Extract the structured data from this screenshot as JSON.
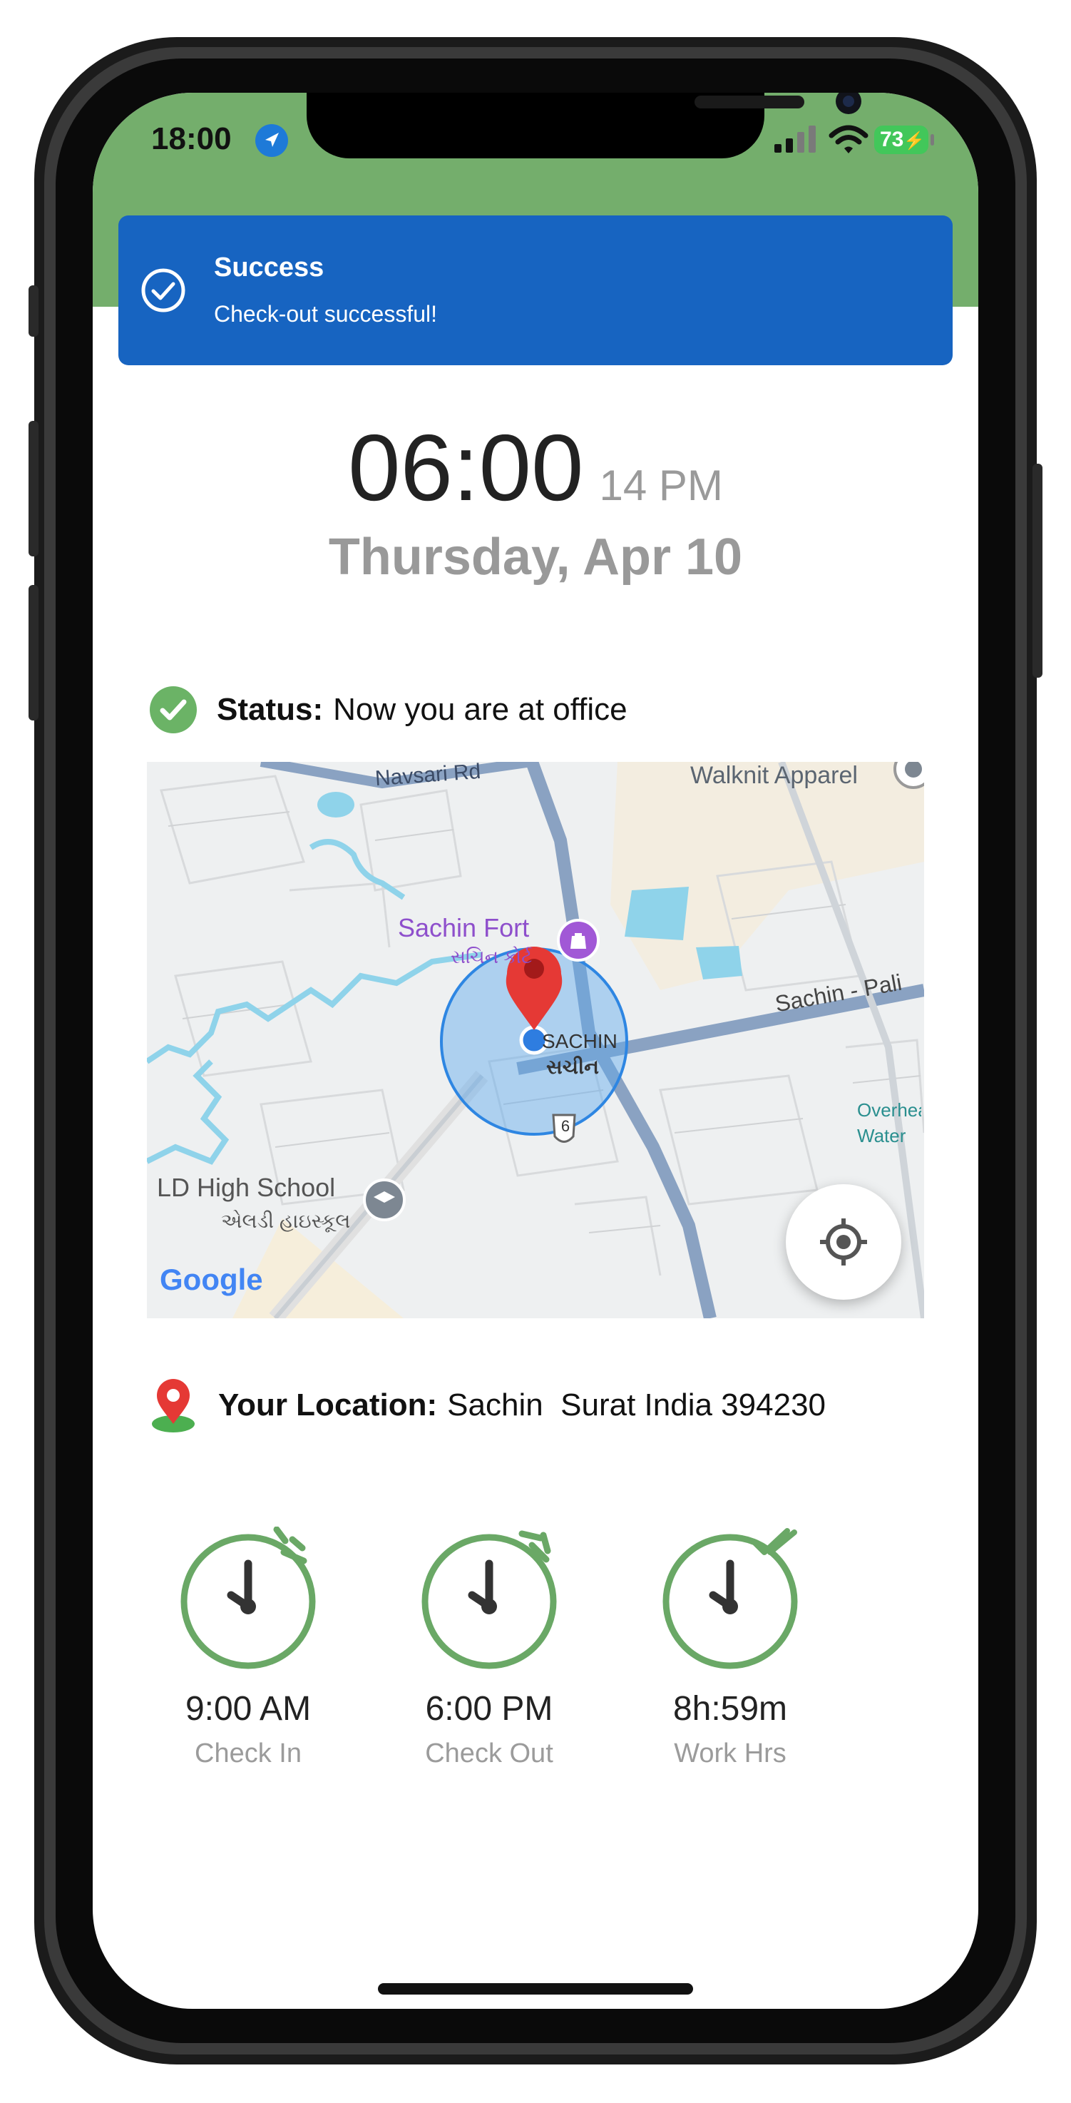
{
  "status_bar": {
    "time": "18:00",
    "battery": "73"
  },
  "toast": {
    "title": "Success",
    "message": "Check-out successful!"
  },
  "clock": {
    "time": "06:00",
    "suffix": "14 PM",
    "date": "Thursday, Apr 10"
  },
  "status": {
    "label": "Status:",
    "value": "Now you are at office"
  },
  "map": {
    "road_navsari": "Navsari Rd",
    "walknit": "Walknit Apparel",
    "sachin_fort": "Sachin Fort",
    "sachin_fort_gu": "સચિન કોર્ટ",
    "sachin": "SACHIN",
    "sachin_gu": "સચીન",
    "sachin_pali": "Sachin - Pali",
    "overhead_water": "Overhead Water",
    "highway": "6",
    "ld_school": "LD High School",
    "ld_school_gu": "એલડી હાઇસ્કૂલ",
    "google": "Google"
  },
  "location": {
    "label": "Your Location:",
    "value": "Sachin  Surat India 394230"
  },
  "stats": [
    {
      "value": "9:00 AM",
      "label": "Check In"
    },
    {
      "value": "6:00 PM",
      "label": "Check Out"
    },
    {
      "value": "8h:59m",
      "label": "Work Hrs"
    }
  ],
  "colors": {
    "accent_green": "#74ae6c",
    "toast_blue": "#1764c1",
    "stat_green": "#6aa866"
  }
}
